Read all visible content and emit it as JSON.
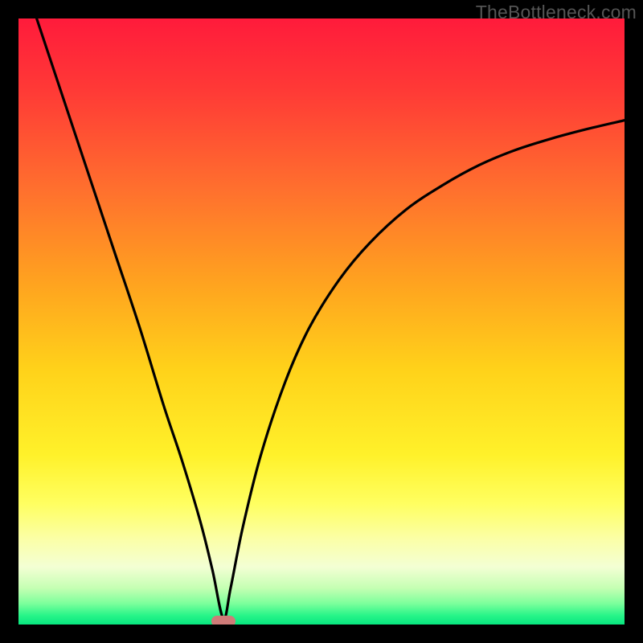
{
  "watermark": {
    "text": "TheBottleneck.com"
  },
  "chart_data": {
    "type": "line",
    "title": "",
    "xlabel": "",
    "ylabel": "",
    "xlim": [
      0,
      100
    ],
    "ylim": [
      0,
      100
    ],
    "series": [
      {
        "name": "bottleneck-curve",
        "x": [
          3,
          5,
          8,
          12,
          16,
          20,
          24,
          27,
          30,
          32,
          33.8,
          35,
          37,
          40,
          44,
          48,
          53,
          58,
          64,
          70,
          76,
          82,
          88,
          94,
          100
        ],
        "y": [
          100,
          94,
          85,
          73,
          61,
          49,
          36,
          27,
          17,
          9,
          1,
          6,
          16,
          28,
          40,
          49,
          57,
          63,
          68.5,
          72.5,
          75.8,
          78.3,
          80.2,
          81.8,
          83.2
        ]
      }
    ],
    "gradient_stops": [
      {
        "pos": 0.0,
        "color": "#ff1b3b"
      },
      {
        "pos": 0.12,
        "color": "#ff3a36"
      },
      {
        "pos": 0.28,
        "color": "#ff6f2e"
      },
      {
        "pos": 0.44,
        "color": "#ffa41f"
      },
      {
        "pos": 0.58,
        "color": "#ffd21a"
      },
      {
        "pos": 0.72,
        "color": "#fff12a"
      },
      {
        "pos": 0.8,
        "color": "#ffff60"
      },
      {
        "pos": 0.86,
        "color": "#fbffa8"
      },
      {
        "pos": 0.905,
        "color": "#f3ffd4"
      },
      {
        "pos": 0.94,
        "color": "#c5ffb3"
      },
      {
        "pos": 0.965,
        "color": "#7dff9c"
      },
      {
        "pos": 0.985,
        "color": "#28f589"
      },
      {
        "pos": 1.0,
        "color": "#08e67f"
      }
    ],
    "marker": {
      "x": 33.8,
      "y": 0.5,
      "label": "optimal-point"
    }
  }
}
